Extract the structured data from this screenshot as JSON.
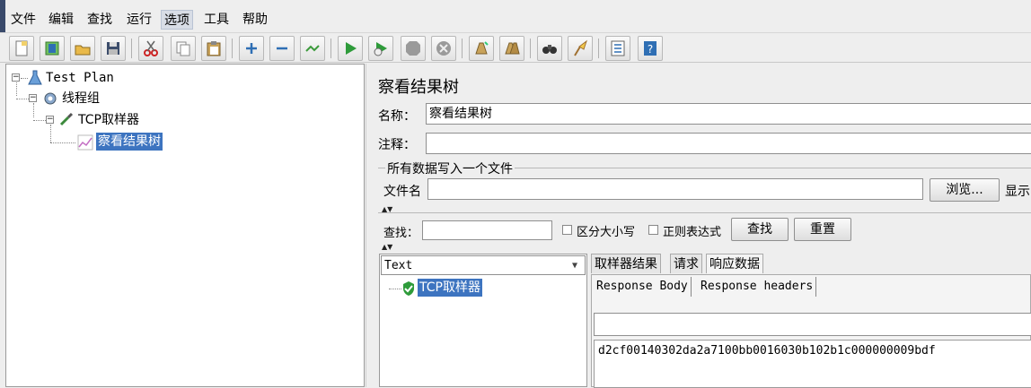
{
  "menubar": {
    "items": [
      "文件",
      "编辑",
      "查找",
      "运行",
      "选项",
      "工具",
      "帮助"
    ],
    "active_index": 4
  },
  "toolbar": {
    "buttons": [
      "new-icon",
      "templates-icon",
      "open-icon",
      "save-icon",
      "cut-icon",
      "copy-icon",
      "paste-icon",
      "expand-icon",
      "collapse-icon",
      "toggle-icon",
      "start-icon",
      "start-no-timers-icon",
      "stop-icon",
      "shutdown-icon",
      "clear-icon",
      "clear-all-icon",
      "search-icon",
      "reset-search-icon",
      "function-helper-icon",
      "help-icon"
    ]
  },
  "tree": {
    "nodes": [
      {
        "label": "Test Plan",
        "icon": "flask-icon"
      },
      {
        "label": "线程组",
        "icon": "gear-icon"
      },
      {
        "label": "TCP取样器",
        "icon": "pipette-icon"
      },
      {
        "label": "察看结果树",
        "icon": "chart-icon",
        "selected": true
      }
    ]
  },
  "panel": {
    "title": "察看结果树",
    "name_label": "名称：",
    "name_value": "察看结果树",
    "comment_label": "注释：",
    "comment_value": "",
    "file_group_label": "所有数据写入一个文件",
    "filename_label": "文件名",
    "filename_value": "",
    "browse_button": "浏览...",
    "display_label": "显示"
  },
  "search": {
    "label": "查找：",
    "value": "",
    "case_label": "区分大小写",
    "regex_label": "正则表达式",
    "find_button": "查找",
    "reset_button": "重置"
  },
  "results": {
    "renderer_selected": "Text",
    "samples": [
      {
        "label": "TCP取样器",
        "status": "success"
      }
    ],
    "tabs": [
      "取样器结果",
      "请求",
      "响应数据"
    ],
    "active_tab": 2,
    "subtabs": [
      "Response Body",
      "Response headers"
    ],
    "active_subtab": 0,
    "response_search_value": "",
    "response_body": "d2cf00140302da2a7100bb0016030b102b1c000000009bdf"
  },
  "colors": {
    "selection": "#3d74c0",
    "success": "#2e9b3a"
  }
}
